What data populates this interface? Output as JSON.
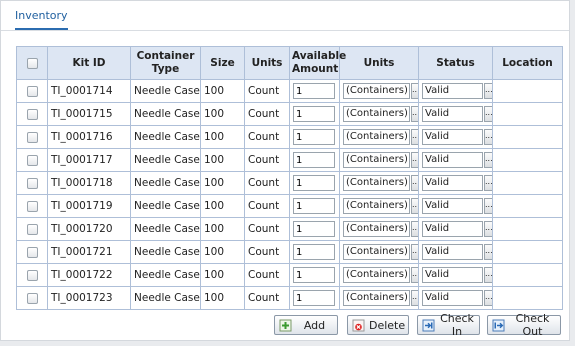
{
  "tab": {
    "label": "Inventory"
  },
  "table": {
    "headers": [
      "",
      "Kit ID",
      "Container Type",
      "Size",
      "Units",
      "Available Amount",
      "Units",
      "Status",
      "Location"
    ],
    "rows": [
      {
        "kit_id": "TI_0001714",
        "container_type": "Needle Case",
        "size": "100",
        "units": "Count",
        "amount": "1",
        "amount_units": "(Containers)",
        "status": "Valid",
        "location": ""
      },
      {
        "kit_id": "TI_0001715",
        "container_type": "Needle Case",
        "size": "100",
        "units": "Count",
        "amount": "1",
        "amount_units": "(Containers)",
        "status": "Valid",
        "location": ""
      },
      {
        "kit_id": "TI_0001716",
        "container_type": "Needle Case",
        "size": "100",
        "units": "Count",
        "amount": "1",
        "amount_units": "(Containers)",
        "status": "Valid",
        "location": ""
      },
      {
        "kit_id": "TI_0001717",
        "container_type": "Needle Case",
        "size": "100",
        "units": "Count",
        "amount": "1",
        "amount_units": "(Containers)",
        "status": "Valid",
        "location": ""
      },
      {
        "kit_id": "TI_0001718",
        "container_type": "Needle Case",
        "size": "100",
        "units": "Count",
        "amount": "1",
        "amount_units": "(Containers)",
        "status": "Valid",
        "location": ""
      },
      {
        "kit_id": "TI_0001719",
        "container_type": "Needle Case",
        "size": "100",
        "units": "Count",
        "amount": "1",
        "amount_units": "(Containers)",
        "status": "Valid",
        "location": ""
      },
      {
        "kit_id": "TI_0001720",
        "container_type": "Needle Case",
        "size": "100",
        "units": "Count",
        "amount": "1",
        "amount_units": "(Containers)",
        "status": "Valid",
        "location": ""
      },
      {
        "kit_id": "TI_0001721",
        "container_type": "Needle Case",
        "size": "100",
        "units": "Count",
        "amount": "1",
        "amount_units": "(Containers)",
        "status": "Valid",
        "location": ""
      },
      {
        "kit_id": "TI_0001722",
        "container_type": "Needle Case",
        "size": "100",
        "units": "Count",
        "amount": "1",
        "amount_units": "(Containers)",
        "status": "Valid",
        "location": ""
      },
      {
        "kit_id": "TI_0001723",
        "container_type": "Needle Case",
        "size": "100",
        "units": "Count",
        "amount": "1",
        "amount_units": "(Containers)",
        "status": "Valid",
        "location": ""
      }
    ],
    "ellipsis": "..."
  },
  "buttons": {
    "add": {
      "label": "Add",
      "icon": "add-icon"
    },
    "delete": {
      "label": "Delete",
      "icon": "delete-icon"
    },
    "check_in": {
      "label": "Check In",
      "icon": "check-in-icon"
    },
    "check_out": {
      "label": "Check Out",
      "icon": "check-out-icon"
    }
  },
  "colors": {
    "tab_accent": "#2b6cb0",
    "header_bg": "#dde6f3",
    "grid_border": "#aebfd8"
  }
}
